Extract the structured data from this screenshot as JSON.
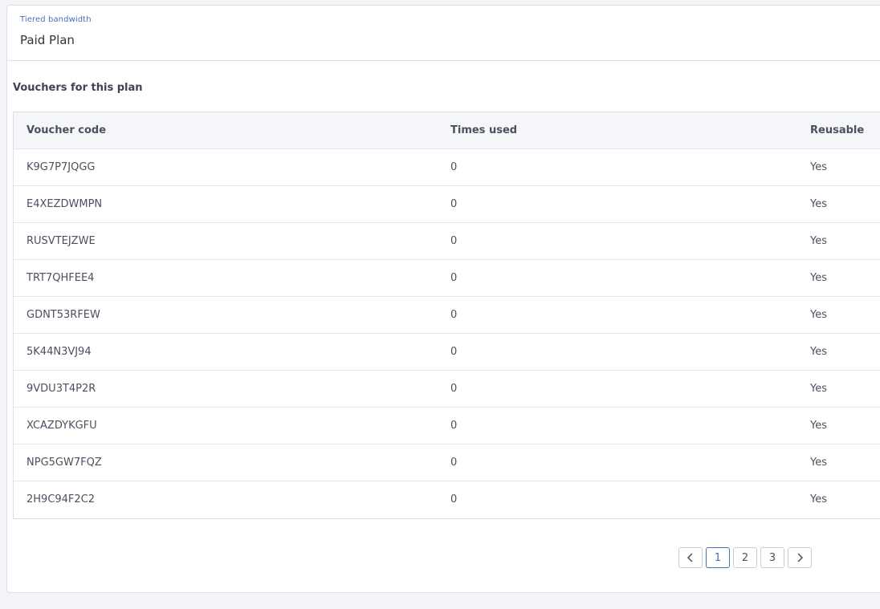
{
  "header": {
    "eyebrow": "Tiered bandwidth",
    "title": "Paid Plan"
  },
  "section": {
    "title": "Vouchers for this plan"
  },
  "table": {
    "columns": [
      "Voucher code",
      "Times used",
      "Reusable"
    ],
    "rows": [
      {
        "code": "K9G7P7JQGG",
        "times_used": "0",
        "reusable": "Yes"
      },
      {
        "code": "E4XEZDWMPN",
        "times_used": "0",
        "reusable": "Yes"
      },
      {
        "code": "RUSVTEJZWE",
        "times_used": "0",
        "reusable": "Yes"
      },
      {
        "code": "TRT7QHFEE4",
        "times_used": "0",
        "reusable": "Yes"
      },
      {
        "code": "GDNT53RFEW",
        "times_used": "0",
        "reusable": "Yes"
      },
      {
        "code": "5K44N3VJ94",
        "times_used": "0",
        "reusable": "Yes"
      },
      {
        "code": "9VDU3T4P2R",
        "times_used": "0",
        "reusable": "Yes"
      },
      {
        "code": "XCAZDYKGFU",
        "times_used": "0",
        "reusable": "Yes"
      },
      {
        "code": "NPG5GW7FQZ",
        "times_used": "0",
        "reusable": "Yes"
      },
      {
        "code": "2H9C94F2C2",
        "times_used": "0",
        "reusable": "Yes"
      }
    ]
  },
  "pagination": {
    "prev_icon": "chevron-left-icon",
    "next_icon": "chevron-right-icon",
    "pages": [
      "1",
      "2",
      "3"
    ],
    "current": "1"
  },
  "colors": {
    "accent": "#4a6fb5",
    "border": "#dcdfe6",
    "header_bg": "#f5f6f9",
    "page_bg": "#f3f4f7"
  }
}
